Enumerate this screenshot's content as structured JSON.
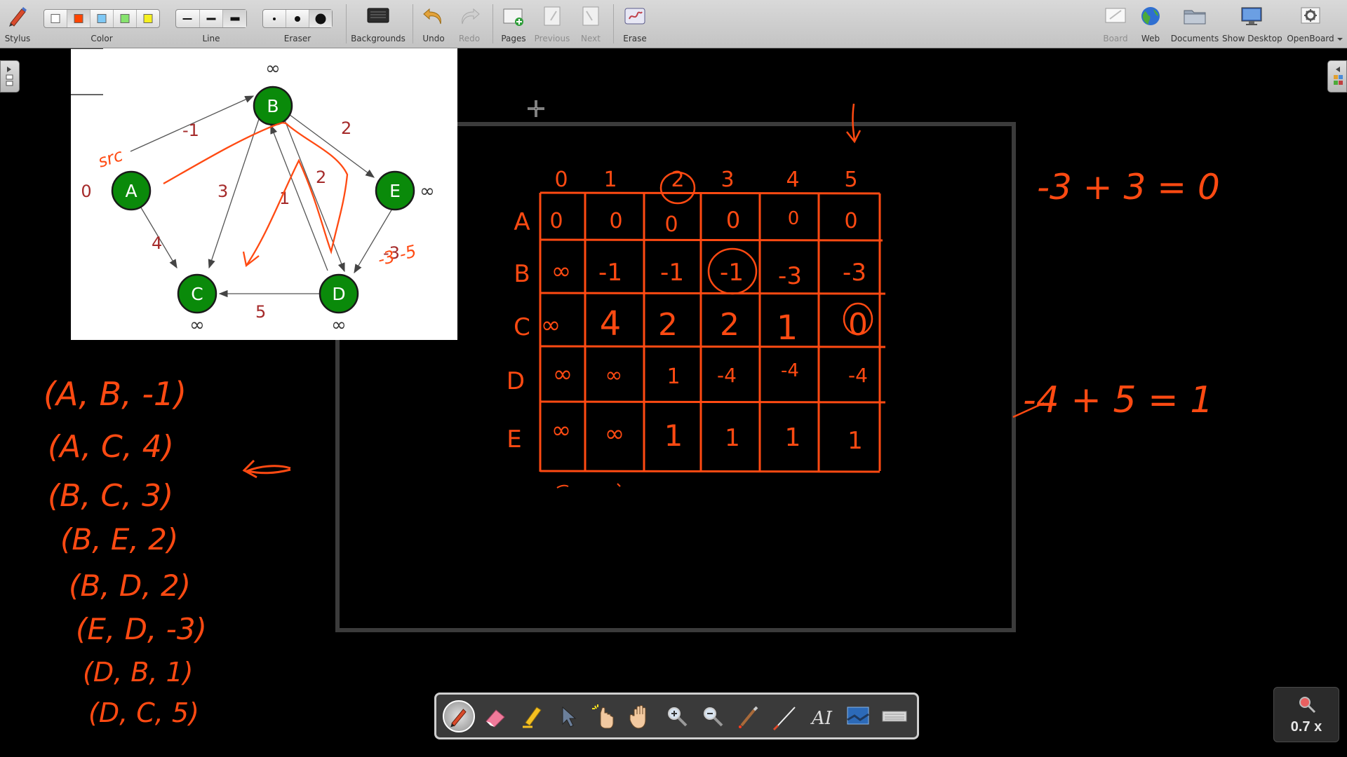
{
  "toolbar": {
    "stylus": "Stylus",
    "color": "Color",
    "line": "Line",
    "eraser": "Eraser",
    "backgrounds": "Backgrounds",
    "undo": "Undo",
    "redo": "Redo",
    "pages": "Pages",
    "previous": "Previous",
    "next": "Next",
    "erase": "Erase",
    "board": "Board",
    "web": "Web",
    "documents": "Documents",
    "show_desktop": "Show Desktop",
    "openboard": "OpenBoard",
    "colors": [
      "#ffffff",
      "#ff4500",
      "#7ec8f5",
      "#86e36e",
      "#f5f020"
    ],
    "selected_color": "#ff4500"
  },
  "palette": {
    "tools": [
      "pen-tool",
      "eraser-tool",
      "highlighter-tool",
      "selector-tool",
      "interact-tool",
      "hand-tool",
      "zoom-in-tool",
      "zoom-out-tool",
      "laser-pointer-tool",
      "line-tool",
      "text-tool",
      "capture-tool",
      "keyboard-tool"
    ],
    "active_tool": "pen-tool"
  },
  "zoom": {
    "value": "0.7 x"
  },
  "graph": {
    "nodes": [
      "A",
      "B",
      "C",
      "D",
      "E"
    ],
    "edge_weights": [
      "-1",
      "4",
      "3",
      "2",
      "2",
      "1",
      "5",
      "-3"
    ],
    "distance_labels": [
      "∞",
      "0",
      "∞",
      "∞",
      "∞"
    ]
  },
  "ink": {
    "matrix_cols": [
      "0",
      "1",
      "2",
      "3",
      "4",
      "5"
    ],
    "matrix_rows": [
      "A",
      "B",
      "C",
      "D",
      "E"
    ],
    "matrix_cells": [
      [
        "0",
        "0",
        "0",
        "0",
        "0",
        "0"
      ],
      [
        "∞",
        "-1",
        "-1",
        "-1",
        "-3",
        "-3"
      ],
      [
        "∞",
        "4",
        "2",
        "2",
        "1",
        "0"
      ],
      [
        "∞",
        "∞",
        "1",
        "-4",
        "-4",
        "-4"
      ],
      [
        "∞",
        "∞",
        "1",
        "1",
        "1",
        "1"
      ]
    ],
    "edges_list": [
      "(A, B, -1)",
      "(A, C, 4)",
      "(B, C, 3)",
      "(B, E, 2)",
      "(B, D, 2)",
      "(E, D, -3)",
      "(D, B, 1)",
      "(D, C, 5)"
    ],
    "equation_1": "-3 + 3 = 0",
    "equation_2": "-4 + 5 = 1",
    "graph_note_1": "src",
    "graph_note_2": "-3 -5"
  }
}
